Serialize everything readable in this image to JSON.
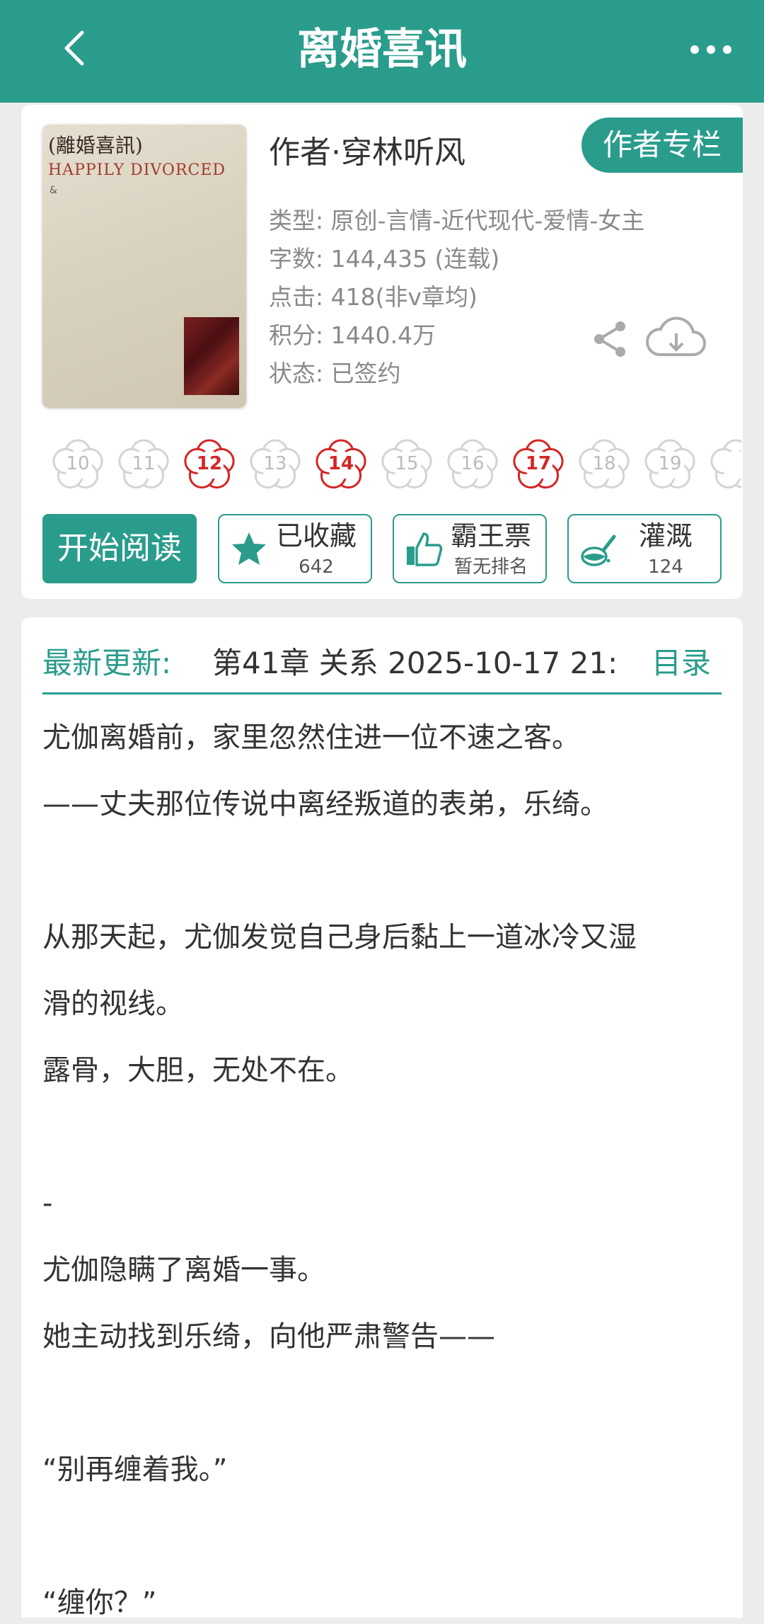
{
  "header": {
    "title": "离婚喜讯"
  },
  "book": {
    "cover_title": "(離婚喜訊)",
    "cover_subtitle": "HAPPILY DIVORCED",
    "cover_amp": "&",
    "author": "作者·穿林听风",
    "author_column_label": "作者专栏",
    "type": "类型: 原创-言情-近代现代-爱情-女主",
    "word_count": "字数: 144,435 (连载)",
    "clicks": "点击: 418(非v章均)",
    "score": "积分: 1440.4万",
    "status": "状态: 已签约"
  },
  "levels": [
    {
      "label": "10",
      "active": false
    },
    {
      "label": "11",
      "active": false
    },
    {
      "label": "12",
      "active": true
    },
    {
      "label": "13",
      "active": false
    },
    {
      "label": "14",
      "active": true
    },
    {
      "label": "15",
      "active": false
    },
    {
      "label": "16",
      "active": false
    },
    {
      "label": "17",
      "active": true
    },
    {
      "label": "18",
      "active": false
    },
    {
      "label": "19",
      "active": false
    },
    {
      "label": "",
      "active": false
    }
  ],
  "actions": {
    "start_reading": "开始阅读",
    "favorite": {
      "label": "已收藏",
      "sub": "642"
    },
    "ticket": {
      "label": "霸王票",
      "sub": "暂无排名"
    },
    "nutrient": {
      "label": "灌溉",
      "sub": "124"
    }
  },
  "latest": {
    "label": "最新更新:",
    "text": "第41章  关系  2025-10-17 21:",
    "toc_label": "目录"
  },
  "description": [
    "尤伽离婚前，家里忽然住进一位不速之客。",
    "——丈夫那位传说中离经叛道的表弟，乐绮。",
    "",
    "从那天起，尤伽发觉自己身后黏上一道冰冷又湿",
    "滑的视线。",
    "露骨，大胆，无处不在。",
    "",
    "-",
    "尤伽隐瞒了离婚一事。",
    "她主动找到乐绮，向他严肃警告——",
    "",
    "“别再缠着我。”",
    "",
    "“缠你？”"
  ],
  "colors": {
    "accent": "#2a9c8c",
    "active_level": "#d32525"
  },
  "icons": [
    "back-icon",
    "more-icon",
    "share-icon",
    "download-icon",
    "star-icon",
    "thumb-up-icon",
    "watering-icon",
    "flower-badge-icon"
  ]
}
